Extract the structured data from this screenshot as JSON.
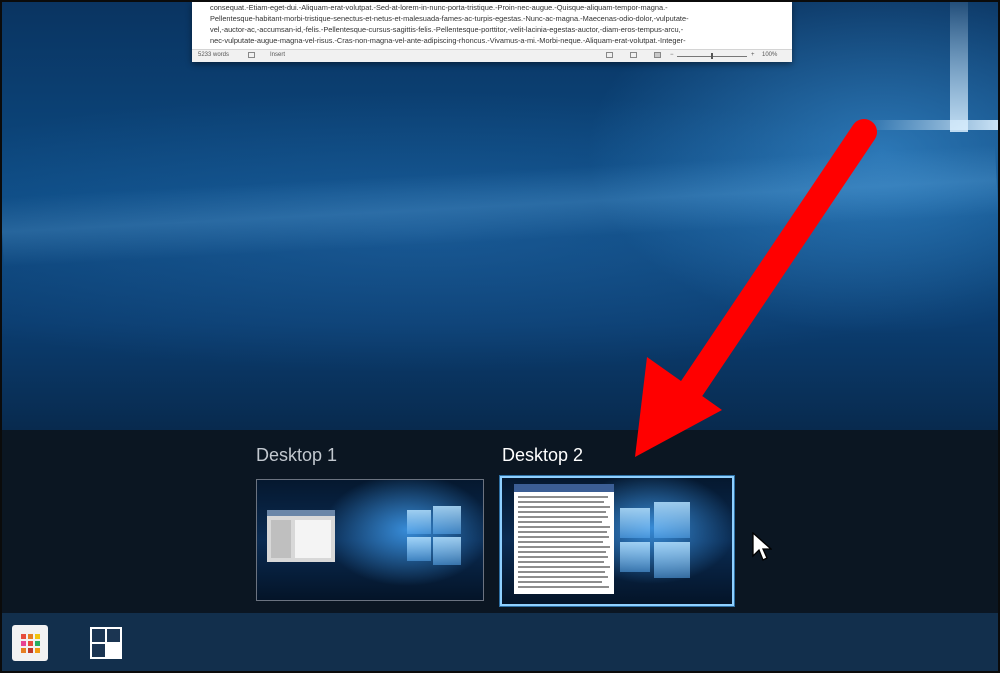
{
  "document": {
    "lines": [
      "consequat.-Etiam-eget-dui.-Aliquam-erat-volutpat.-Sed-at-lorem-in-nunc-porta-tristique.-Proin-nec-augue.-Quisque-aliquam-tempor-magna.-",
      "Pellentesque-habitant-morbi-tristique-senectus-et-netus-et-malesuada-fames-ac-turpis-egestas.-Nunc-ac-magna.-Maecenas-odio-dolor,-vulputate-",
      "vel,-auctor-ac,-accumsan-id,-felis.-Pellentesque-cursus-sagittis-felis.-Pellentesque-porttitor,-velit-lacinia-egestas-auctor,-diam-eros-tempus-arcu,-",
      "nec-vulputate-augue-magna-vel-risus.-Cras-non-magna-vel-ante-adipiscing-rhoncus.-Vivamus-a-mi.-Morbi-neque.-Aliquam-erat-volutpat.-Integer-"
    ],
    "status": {
      "word_count": "5233 words",
      "mode": "Insert",
      "zoom": "100%"
    }
  },
  "task_view": {
    "desktops": [
      {
        "label": "Desktop 1",
        "selected": false
      },
      {
        "label": "Desktop 2",
        "selected": true
      }
    ]
  },
  "taskbar": {
    "start_icon": "apps-grid-icon",
    "task_view_icon": "task-view-icon"
  },
  "colors": {
    "arrow": "#ff0000",
    "selection_border": "#8fd0ff",
    "taskbar": "#122f4c"
  }
}
